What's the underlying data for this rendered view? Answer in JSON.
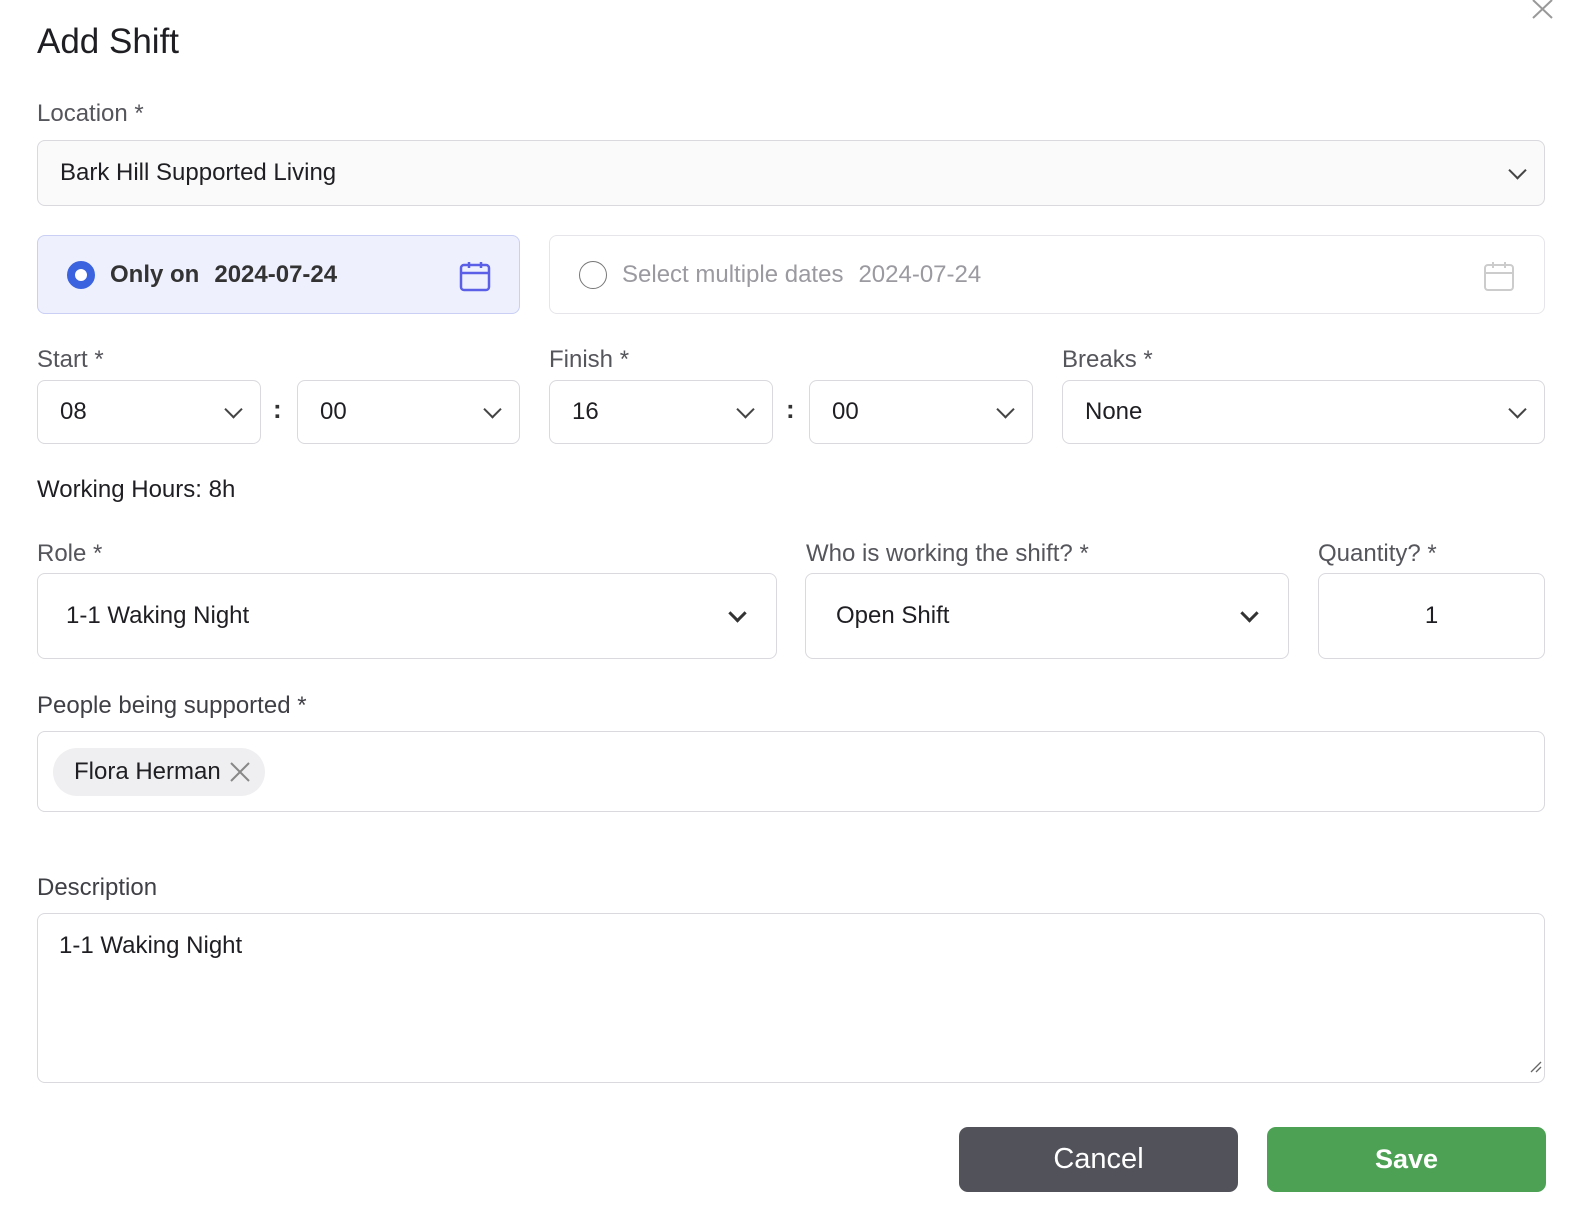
{
  "dialog": {
    "title": "Add Shift"
  },
  "location": {
    "label": "Location *",
    "value": "Bark Hill Supported Living"
  },
  "date_mode": {
    "only_on_label": "Only on",
    "only_on_date": "2024-07-24",
    "multiple_label": "Select multiple dates",
    "multiple_date": "2024-07-24",
    "selected": "only_on"
  },
  "start": {
    "label": "Start *",
    "hour": "08",
    "minute": "00"
  },
  "finish": {
    "label": "Finish *",
    "hour": "16",
    "minute": "00"
  },
  "breaks": {
    "label": "Breaks *",
    "value": "None"
  },
  "working_hours": "Working Hours: 8h",
  "role": {
    "label": "Role *",
    "value": "1-1 Waking Night"
  },
  "who": {
    "label": "Who is working the shift? *",
    "value": "Open Shift"
  },
  "quantity": {
    "label": "Quantity? *",
    "value": "1"
  },
  "people": {
    "label": "People being supported *",
    "chips": [
      "Flora Herman"
    ]
  },
  "description": {
    "label": "Description",
    "value": "1-1 Waking Night"
  },
  "buttons": {
    "cancel": "Cancel",
    "save": "Save"
  },
  "colors": {
    "accent": "#3b63e0",
    "save": "#4ca154",
    "cancel": "#52525b"
  }
}
